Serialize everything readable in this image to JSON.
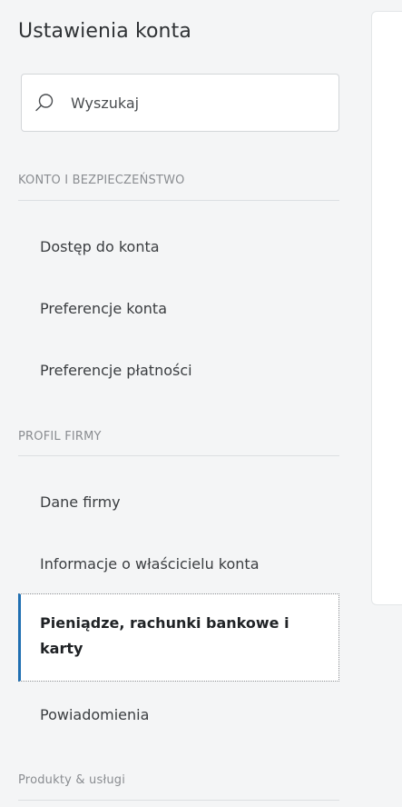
{
  "sidebar": {
    "title": "Ustawienia konta",
    "search": {
      "placeholder": "Wyszukaj",
      "icon": "search-icon"
    },
    "sections": [
      {
        "header": "KONTO I BEZPIECZEŃSTWO",
        "items": [
          {
            "label": "Dostęp do konta"
          },
          {
            "label": "Preferencje konta"
          },
          {
            "label": "Preferencje płatności"
          }
        ]
      },
      {
        "header": "PROFIL FIRMY",
        "items": [
          {
            "label": "Dane firmy"
          },
          {
            "label": "Informacje o właścicielu konta"
          },
          {
            "label": "Pieniądze, rachunki bankowe i karty",
            "active": true
          },
          {
            "label": "Powiadomienia"
          }
        ]
      },
      {
        "header": "Produkty & usługi",
        "items": []
      }
    ]
  },
  "colors": {
    "background": "#f4f5f6",
    "active_accent": "#1f6fb2",
    "section_header": "#8a8d91"
  }
}
